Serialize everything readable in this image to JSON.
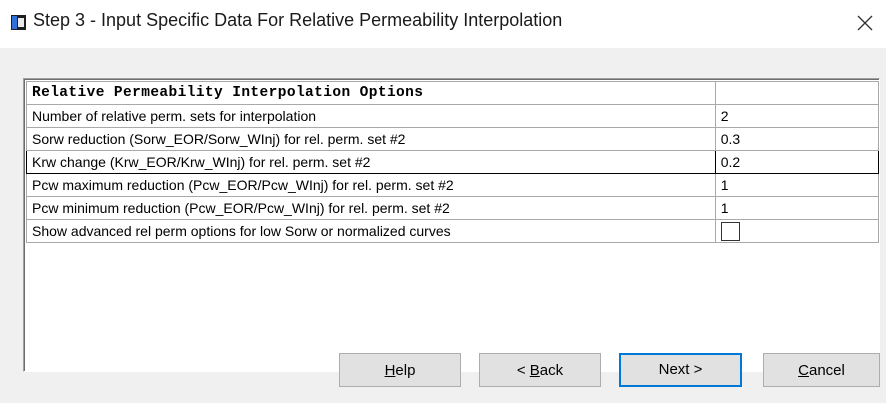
{
  "window": {
    "title": "Step 3 - Input Specific Data For Relative Permeability Interpolation",
    "close_glyph": "×"
  },
  "table": {
    "header": "Relative Permeability Interpolation Options",
    "rows": [
      {
        "label": "Number of relative perm. sets for interpolation",
        "value": "2"
      },
      {
        "label": "Sorw reduction (Sorw_EOR/Sorw_WInj) for rel. perm. set #2",
        "value": "0.3"
      },
      {
        "label": "Krw change (Krw_EOR/Krw_WInj) for rel. perm. set #2",
        "value": "0.2"
      },
      {
        "label": "Pcw maximum reduction (Pcw_EOR/Pcw_WInj) for rel. perm. set #2",
        "value": "1"
      },
      {
        "label": "Pcw minimum reduction (Pcw_EOR/Pcw_WInj) for rel. perm. set #2",
        "value": "1"
      },
      {
        "label": "Show advanced rel perm options for low Sorw or normalized curves",
        "checked": false
      }
    ]
  },
  "buttons": {
    "help": {
      "mnemonic": "H",
      "rest": "elp"
    },
    "back": {
      "prefix": "< ",
      "mnemonic": "B",
      "rest": "ack"
    },
    "next": {
      "label": "Next >"
    },
    "cancel": {
      "mnemonic": "C",
      "rest": "ancel"
    }
  },
  "colors": {
    "dialog_bg": "#f0f0f0",
    "default_button_border": "#0078d7",
    "grid_line": "#a9a9a9"
  },
  "icons": {
    "app": "app-window-icon",
    "close": "close-icon"
  }
}
